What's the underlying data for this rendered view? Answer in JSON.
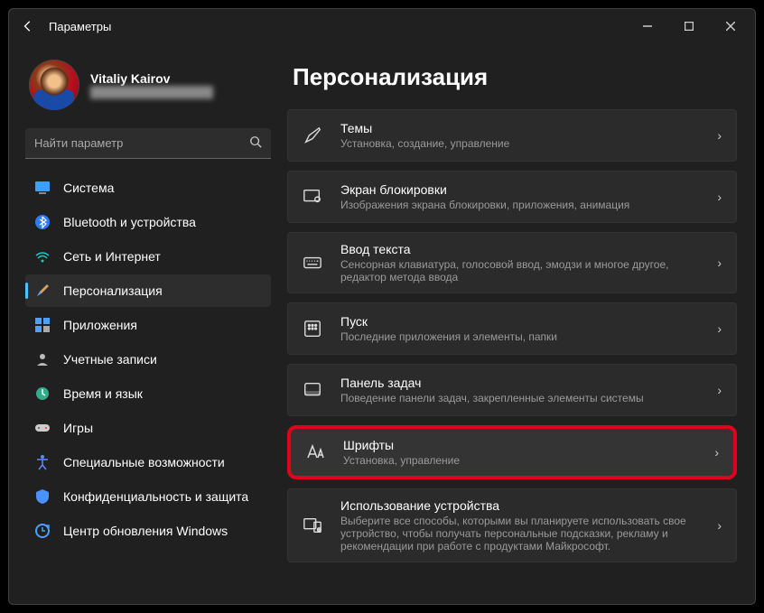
{
  "window": {
    "title": "Параметры"
  },
  "user": {
    "name": "Vitaliy Kairov",
    "email": "████████████████"
  },
  "search": {
    "placeholder": "Найти параметр"
  },
  "sidebar": {
    "items": [
      {
        "label": "Система"
      },
      {
        "label": "Bluetooth и устройства"
      },
      {
        "label": "Сеть и Интернет"
      },
      {
        "label": "Персонализация"
      },
      {
        "label": "Приложения"
      },
      {
        "label": "Учетные записи"
      },
      {
        "label": "Время и язык"
      },
      {
        "label": "Игры"
      },
      {
        "label": "Специальные возможности"
      },
      {
        "label": "Конфиденциальность и защита"
      },
      {
        "label": "Центр обновления Windows"
      }
    ]
  },
  "page": {
    "title": "Персонализация"
  },
  "cards": [
    {
      "title": "Темы",
      "sub": "Установка, создание, управление"
    },
    {
      "title": "Экран блокировки",
      "sub": "Изображения экрана блокировки, приложения, анимация"
    },
    {
      "title": "Ввод текста",
      "sub": "Сенсорная клавиатура, голосовой ввод, эмодзи и многое другое, редактор метода ввода"
    },
    {
      "title": "Пуск",
      "sub": "Последние приложения и элементы, папки"
    },
    {
      "title": "Панель задач",
      "sub": "Поведение панели задач, закрепленные элементы системы"
    },
    {
      "title": "Шрифты",
      "sub": "Установка, управление"
    },
    {
      "title": "Использование устройства",
      "sub": "Выберите все способы, которыми вы планируете использовать свое устройство, чтобы получать персональные подсказки, рекламу и рекомендации при работе с продуктами Майкрософт."
    }
  ]
}
